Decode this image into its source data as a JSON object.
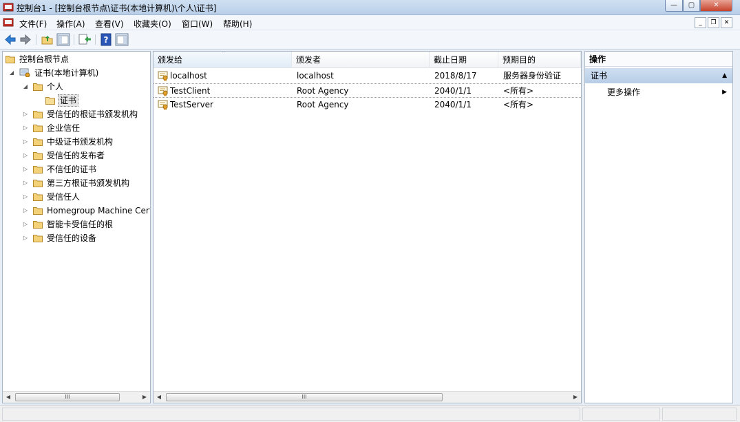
{
  "window": {
    "title": "控制台1 - [控制台根节点\\证书(本地计算机)\\个人\\证书]",
    "controls": {
      "minimize": "—",
      "maximize": "▢",
      "close": "✕"
    }
  },
  "menu": {
    "items": [
      "文件(F)",
      "操作(A)",
      "查看(V)",
      "收藏夹(O)",
      "窗口(W)",
      "帮助(H)"
    ],
    "mdi_controls": {
      "minimize": "_",
      "restore": "❐",
      "close": "✕"
    }
  },
  "toolbar": {
    "icons": [
      "back-icon",
      "forward-icon",
      "up-folder-icon",
      "show-hide-tree-icon",
      "export-list-icon",
      "help-icon",
      "action-pane-icon"
    ]
  },
  "tree": {
    "root": "控制台根节点",
    "computer": "证书(本地计算机)",
    "personal": "个人",
    "certificates": "证书",
    "stores": [
      "受信任的根证书颁发机构",
      "企业信任",
      "中级证书颁发机构",
      "受信任的发布者",
      "不信任的证书",
      "第三方根证书颁发机构",
      "受信任人",
      "Homegroup Machine Cert",
      "智能卡受信任的根",
      "受信任的设备"
    ]
  },
  "list": {
    "columns": [
      "颁发给",
      "颁发者",
      "截止日期",
      "预期目的"
    ],
    "rows": [
      {
        "issued_to": "localhost",
        "issued_by": "localhost",
        "expires": "2018/8/17",
        "purpose": "服务器身份验证"
      },
      {
        "issued_to": "TestClient",
        "issued_by": "Root Agency",
        "expires": "2040/1/1",
        "purpose": "<所有>"
      },
      {
        "issued_to": "TestServer",
        "issued_by": "Root Agency",
        "expires": "2040/1/1",
        "purpose": "<所有>"
      }
    ]
  },
  "actions": {
    "title": "操作",
    "section": "证书",
    "more": "更多操作"
  },
  "scroll": {
    "left_arrow": "◀",
    "right_arrow": "▶",
    "grip": "III"
  },
  "colors": {
    "accent": "#b7cde6",
    "folder": "#f3d27a"
  }
}
